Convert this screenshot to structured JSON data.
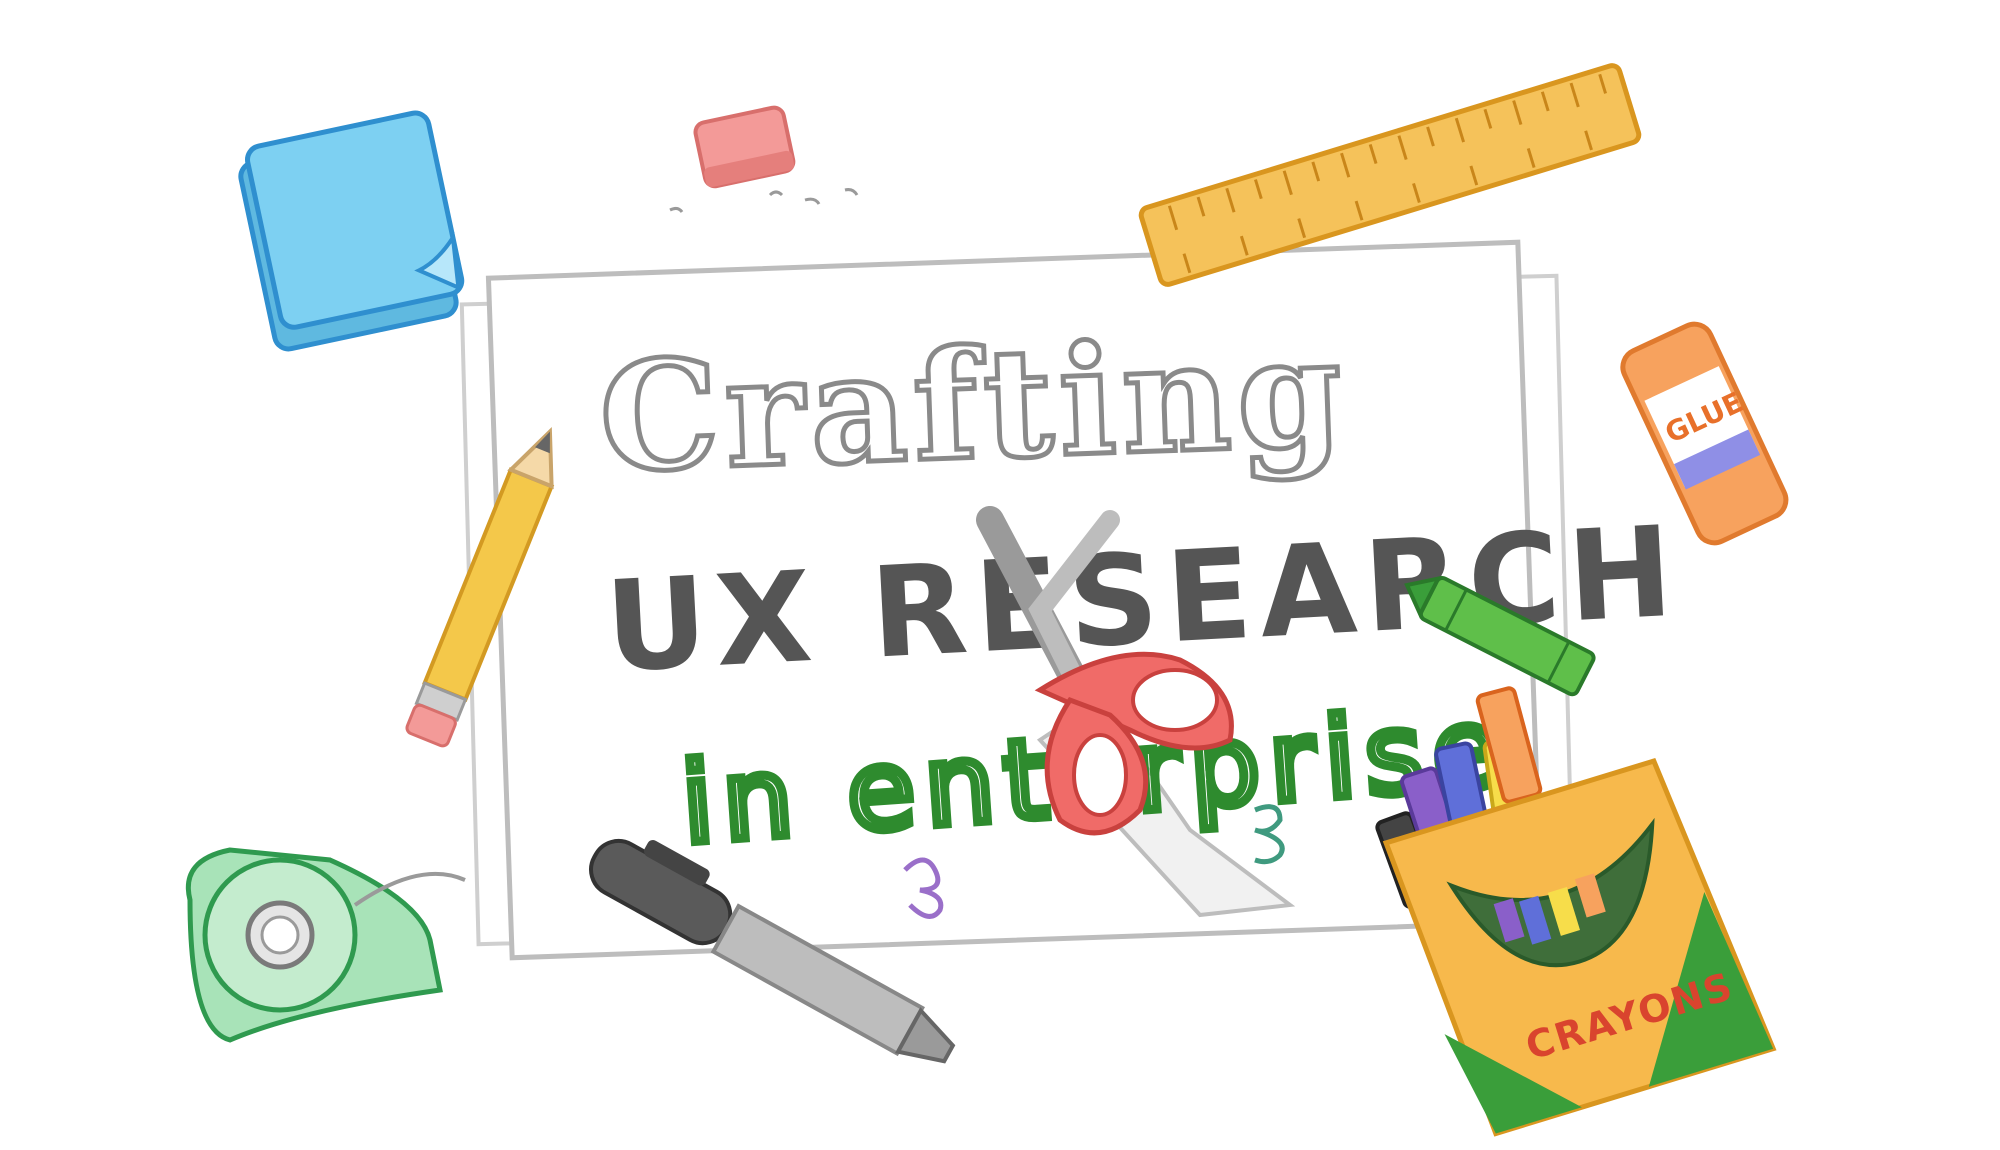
{
  "title": {
    "line1": "Crafting",
    "line2": "UX RESEARCH",
    "line3": "in enterprise"
  },
  "labels": {
    "glue": "GLUE",
    "crayons": "CRAYONS"
  },
  "colors": {
    "sticky_note": "#7dd0f2",
    "eraser": "#f39a98",
    "ruler": "#f5c25a",
    "glue_body": "#ffffff",
    "glue_cap": "#f7a25e",
    "glue_band": "#8f8fe6",
    "crayon_green": "#5fbf4a",
    "pencil": "#f4c84a",
    "tape": "#a8e3b8",
    "marker": "#5a5a5a",
    "scissors": "#f06b68",
    "crayon_box": "#f7b94c",
    "enterprise_text": "#2e8b2e"
  },
  "icons": [
    "sticky-note-icon",
    "eraser-icon",
    "ruler-icon",
    "glue-stick-icon",
    "crayon-icon",
    "pencil-icon",
    "tape-dispenser-icon",
    "marker-icon",
    "scissors-icon",
    "crayon-box-icon"
  ]
}
